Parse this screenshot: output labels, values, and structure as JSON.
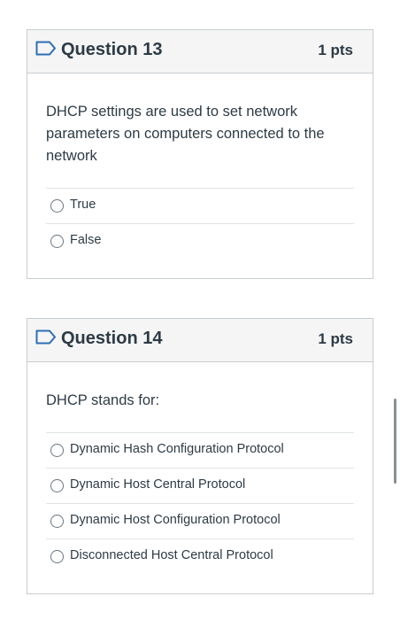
{
  "questions": [
    {
      "title": "Question 13",
      "points": "1 pts",
      "text": "DHCP  settings are used to set network parameters on computers connected to the network",
      "answers": [
        "True",
        "False"
      ]
    },
    {
      "title": "Question 14",
      "points": "1 pts",
      "text": "DHCP stands for:",
      "answers": [
        "Dynamic Hash Configuration Protocol",
        "Dynamic Host Central Protocol",
        "Dynamic Host Configuration Protocol",
        "Disconnected Host Central Protocol"
      ]
    }
  ],
  "colors": {
    "flag": "#2d6fb3",
    "header_bg": "#f5f5f5",
    "border": "#c7cdd1",
    "text": "#2d3b45"
  },
  "icons": {
    "flag": "flag-question-icon",
    "radio": "radio-unchecked-icon"
  }
}
